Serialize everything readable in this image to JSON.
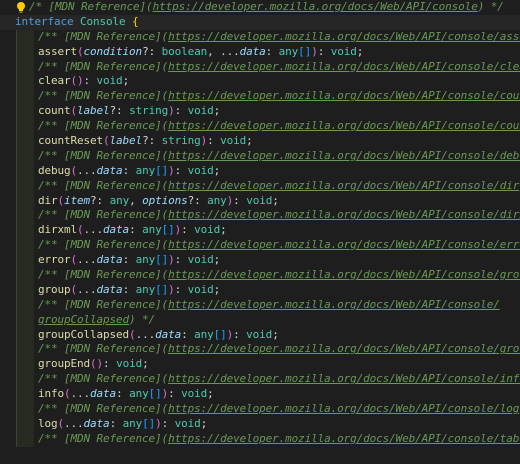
{
  "editor": {
    "icon": "lightbulb-icon",
    "lines": [
      {
        "kind": "top-comment",
        "tokens": [
          {
            "t": "/* ",
            "c": "t-comment"
          },
          {
            "t": "[MDN Reference](",
            "c": "t-comment"
          },
          {
            "t": "https://developer.mozilla.org/docs/Web/API/console",
            "c": "t-link"
          },
          {
            "t": ") */",
            "c": "t-comment"
          }
        ]
      },
      {
        "kind": "decl",
        "tokens": [
          {
            "t": "interface",
            "c": "t-keyword"
          },
          {
            "t": " ",
            "c": "t-punct"
          },
          {
            "t": "Console",
            "c": "t-type"
          },
          {
            "t": " ",
            "c": "t-punct"
          },
          {
            "t": "{",
            "c": "t-brace"
          }
        ]
      },
      {
        "kind": "comment",
        "tokens": [
          {
            "t": "/** [MDN Reference](",
            "c": "t-comment"
          },
          {
            "t": "https://developer.mozilla.org/docs/Web/API/console/assert",
            "c": "t-link"
          },
          {
            "t": ") */",
            "c": "t-comment"
          }
        ]
      },
      {
        "kind": "code",
        "tokens": [
          {
            "t": "assert",
            "c": "t-func"
          },
          {
            "t": "(",
            "c": "t-paren"
          },
          {
            "t": "condition",
            "c": "t-param"
          },
          {
            "t": "?: ",
            "c": "t-punct"
          },
          {
            "t": "boolean",
            "c": "t-type"
          },
          {
            "t": ", ...",
            "c": "t-punct"
          },
          {
            "t": "data",
            "c": "t-param"
          },
          {
            "t": ": ",
            "c": "t-punct"
          },
          {
            "t": "any",
            "c": "t-type"
          },
          {
            "t": "[]",
            "c": "t-bracket"
          },
          {
            "t": ")",
            "c": "t-paren"
          },
          {
            "t": ": ",
            "c": "t-punct"
          },
          {
            "t": "void",
            "c": "t-type"
          },
          {
            "t": ";",
            "c": "t-punct"
          }
        ]
      },
      {
        "kind": "comment",
        "tokens": [
          {
            "t": "/** [MDN Reference](",
            "c": "t-comment"
          },
          {
            "t": "https://developer.mozilla.org/docs/Web/API/console/clear",
            "c": "t-link"
          },
          {
            "t": ") */",
            "c": "t-comment"
          }
        ]
      },
      {
        "kind": "code",
        "tokens": [
          {
            "t": "clear",
            "c": "t-func"
          },
          {
            "t": "()",
            "c": "t-paren"
          },
          {
            "t": ": ",
            "c": "t-punct"
          },
          {
            "t": "void",
            "c": "t-type"
          },
          {
            "t": ";",
            "c": "t-punct"
          }
        ]
      },
      {
        "kind": "comment",
        "tokens": [
          {
            "t": "/** [MDN Reference](",
            "c": "t-comment"
          },
          {
            "t": "https://developer.mozilla.org/docs/Web/API/console/count",
            "c": "t-link"
          },
          {
            "t": ") */",
            "c": "t-comment"
          }
        ]
      },
      {
        "kind": "code",
        "tokens": [
          {
            "t": "count",
            "c": "t-func"
          },
          {
            "t": "(",
            "c": "t-paren"
          },
          {
            "t": "label",
            "c": "t-param"
          },
          {
            "t": "?: ",
            "c": "t-punct"
          },
          {
            "t": "string",
            "c": "t-type"
          },
          {
            "t": ")",
            "c": "t-paren"
          },
          {
            "t": ": ",
            "c": "t-punct"
          },
          {
            "t": "void",
            "c": "t-type"
          },
          {
            "t": ";",
            "c": "t-punct"
          }
        ]
      },
      {
        "kind": "comment",
        "tokens": [
          {
            "t": "/** [MDN Reference](",
            "c": "t-comment"
          },
          {
            "t": "https://developer.mozilla.org/docs/Web/API/console/countReset",
            "c": "t-link"
          }
        ]
      },
      {
        "kind": "code",
        "tokens": [
          {
            "t": "countReset",
            "c": "t-func"
          },
          {
            "t": "(",
            "c": "t-paren"
          },
          {
            "t": "label",
            "c": "t-param"
          },
          {
            "t": "?: ",
            "c": "t-punct"
          },
          {
            "t": "string",
            "c": "t-type"
          },
          {
            "t": ")",
            "c": "t-paren"
          },
          {
            "t": ": ",
            "c": "t-punct"
          },
          {
            "t": "void",
            "c": "t-type"
          },
          {
            "t": ";",
            "c": "t-punct"
          }
        ]
      },
      {
        "kind": "comment",
        "tokens": [
          {
            "t": "/** [MDN Reference](",
            "c": "t-comment"
          },
          {
            "t": "https://developer.mozilla.org/docs/Web/API/console/debug",
            "c": "t-link"
          },
          {
            "t": ") */",
            "c": "t-comment"
          }
        ]
      },
      {
        "kind": "code",
        "tokens": [
          {
            "t": "debug",
            "c": "t-func"
          },
          {
            "t": "(",
            "c": "t-paren"
          },
          {
            "t": "...",
            "c": "t-punct"
          },
          {
            "t": "data",
            "c": "t-param"
          },
          {
            "t": ": ",
            "c": "t-punct"
          },
          {
            "t": "any",
            "c": "t-type"
          },
          {
            "t": "[]",
            "c": "t-bracket"
          },
          {
            "t": ")",
            "c": "t-paren"
          },
          {
            "t": ": ",
            "c": "t-punct"
          },
          {
            "t": "void",
            "c": "t-type"
          },
          {
            "t": ";",
            "c": "t-punct"
          }
        ]
      },
      {
        "kind": "comment",
        "tokens": [
          {
            "t": "/** [MDN Reference](",
            "c": "t-comment"
          },
          {
            "t": "https://developer.mozilla.org/docs/Web/API/console/dir",
            "c": "t-link"
          },
          {
            "t": ") */",
            "c": "t-comment"
          }
        ]
      },
      {
        "kind": "code",
        "tokens": [
          {
            "t": "dir",
            "c": "t-func"
          },
          {
            "t": "(",
            "c": "t-paren"
          },
          {
            "t": "item",
            "c": "t-param"
          },
          {
            "t": "?: ",
            "c": "t-punct"
          },
          {
            "t": "any",
            "c": "t-type"
          },
          {
            "t": ", ",
            "c": "t-punct"
          },
          {
            "t": "options",
            "c": "t-param"
          },
          {
            "t": "?: ",
            "c": "t-punct"
          },
          {
            "t": "any",
            "c": "t-type"
          },
          {
            "t": ")",
            "c": "t-paren"
          },
          {
            "t": ": ",
            "c": "t-punct"
          },
          {
            "t": "void",
            "c": "t-type"
          },
          {
            "t": ";",
            "c": "t-punct"
          }
        ]
      },
      {
        "kind": "comment",
        "tokens": [
          {
            "t": "/** [MDN Reference](",
            "c": "t-comment"
          },
          {
            "t": "https://developer.mozilla.org/docs/Web/API/console/dirxml",
            "c": "t-link"
          },
          {
            "t": ") */",
            "c": "t-comment"
          }
        ]
      },
      {
        "kind": "code",
        "tokens": [
          {
            "t": "dirxml",
            "c": "t-func"
          },
          {
            "t": "(",
            "c": "t-paren"
          },
          {
            "t": "...",
            "c": "t-punct"
          },
          {
            "t": "data",
            "c": "t-param"
          },
          {
            "t": ": ",
            "c": "t-punct"
          },
          {
            "t": "any",
            "c": "t-type"
          },
          {
            "t": "[]",
            "c": "t-bracket"
          },
          {
            "t": ")",
            "c": "t-paren"
          },
          {
            "t": ": ",
            "c": "t-punct"
          },
          {
            "t": "void",
            "c": "t-type"
          },
          {
            "t": ";",
            "c": "t-punct"
          }
        ]
      },
      {
        "kind": "comment",
        "tokens": [
          {
            "t": "/** [MDN Reference](",
            "c": "t-comment"
          },
          {
            "t": "https://developer.mozilla.org/docs/Web/API/console/error",
            "c": "t-link"
          },
          {
            "t": ") */",
            "c": "t-comment"
          }
        ]
      },
      {
        "kind": "code",
        "tokens": [
          {
            "t": "error",
            "c": "t-func"
          },
          {
            "t": "(",
            "c": "t-paren"
          },
          {
            "t": "...",
            "c": "t-punct"
          },
          {
            "t": "data",
            "c": "t-param"
          },
          {
            "t": ": ",
            "c": "t-punct"
          },
          {
            "t": "any",
            "c": "t-type"
          },
          {
            "t": "[]",
            "c": "t-bracket"
          },
          {
            "t": ")",
            "c": "t-paren"
          },
          {
            "t": ": ",
            "c": "t-punct"
          },
          {
            "t": "void",
            "c": "t-type"
          },
          {
            "t": ";",
            "c": "t-punct"
          }
        ]
      },
      {
        "kind": "comment",
        "tokens": [
          {
            "t": "/** [MDN Reference](",
            "c": "t-comment"
          },
          {
            "t": "https://developer.mozilla.org/docs/Web/API/console/group",
            "c": "t-link"
          },
          {
            "t": ") */",
            "c": "t-comment"
          }
        ]
      },
      {
        "kind": "code",
        "tokens": [
          {
            "t": "group",
            "c": "t-func"
          },
          {
            "t": "(",
            "c": "t-paren"
          },
          {
            "t": "...",
            "c": "t-punct"
          },
          {
            "t": "data",
            "c": "t-param"
          },
          {
            "t": ": ",
            "c": "t-punct"
          },
          {
            "t": "any",
            "c": "t-type"
          },
          {
            "t": "[]",
            "c": "t-bracket"
          },
          {
            "t": ")",
            "c": "t-paren"
          },
          {
            "t": ": ",
            "c": "t-punct"
          },
          {
            "t": "void",
            "c": "t-type"
          },
          {
            "t": ";",
            "c": "t-punct"
          }
        ]
      },
      {
        "kind": "comment",
        "tokens": [
          {
            "t": "/** [MDN Reference](",
            "c": "t-comment"
          },
          {
            "t": "https://developer.mozilla.org/docs/Web/API/console/",
            "c": "t-link"
          }
        ]
      },
      {
        "kind": "comment-wrap",
        "tokens": [
          {
            "t": "groupCollapsed",
            "c": "t-link"
          },
          {
            "t": ") */",
            "c": "t-comment"
          }
        ]
      },
      {
        "kind": "code",
        "tokens": [
          {
            "t": "groupCollapsed",
            "c": "t-func"
          },
          {
            "t": "(",
            "c": "t-paren"
          },
          {
            "t": "...",
            "c": "t-punct"
          },
          {
            "t": "data",
            "c": "t-param"
          },
          {
            "t": ": ",
            "c": "t-punct"
          },
          {
            "t": "any",
            "c": "t-type"
          },
          {
            "t": "[]",
            "c": "t-bracket"
          },
          {
            "t": ")",
            "c": "t-paren"
          },
          {
            "t": ": ",
            "c": "t-punct"
          },
          {
            "t": "void",
            "c": "t-type"
          },
          {
            "t": ";",
            "c": "t-punct"
          }
        ]
      },
      {
        "kind": "comment",
        "tokens": [
          {
            "t": "/** [MDN Reference](",
            "c": "t-comment"
          },
          {
            "t": "https://developer.mozilla.org/docs/Web/API/console/groupEnd",
            "c": "t-link"
          },
          {
            "t": ")",
            "c": "t-comment"
          }
        ]
      },
      {
        "kind": "code",
        "tokens": [
          {
            "t": "groupEnd",
            "c": "t-func"
          },
          {
            "t": "()",
            "c": "t-paren"
          },
          {
            "t": ": ",
            "c": "t-punct"
          },
          {
            "t": "void",
            "c": "t-type"
          },
          {
            "t": ";",
            "c": "t-punct"
          }
        ]
      },
      {
        "kind": "comment",
        "tokens": [
          {
            "t": "/** [MDN Reference](",
            "c": "t-comment"
          },
          {
            "t": "https://developer.mozilla.org/docs/Web/API/console/info",
            "c": "t-link"
          },
          {
            "t": ") */",
            "c": "t-comment"
          }
        ]
      },
      {
        "kind": "code",
        "tokens": [
          {
            "t": "info",
            "c": "t-func"
          },
          {
            "t": "(",
            "c": "t-paren"
          },
          {
            "t": "...",
            "c": "t-punct"
          },
          {
            "t": "data",
            "c": "t-param"
          },
          {
            "t": ": ",
            "c": "t-punct"
          },
          {
            "t": "any",
            "c": "t-type"
          },
          {
            "t": "[]",
            "c": "t-bracket"
          },
          {
            "t": ")",
            "c": "t-paren"
          },
          {
            "t": ": ",
            "c": "t-punct"
          },
          {
            "t": "void",
            "c": "t-type"
          },
          {
            "t": ";",
            "c": "t-punct"
          }
        ]
      },
      {
        "kind": "comment",
        "tokens": [
          {
            "t": "/** [MDN Reference](",
            "c": "t-comment"
          },
          {
            "t": "https://developer.mozilla.org/docs/Web/API/console/log",
            "c": "t-link"
          },
          {
            "t": ") */",
            "c": "t-comment"
          }
        ]
      },
      {
        "kind": "code",
        "tokens": [
          {
            "t": "log",
            "c": "t-func"
          },
          {
            "t": "(",
            "c": "t-paren"
          },
          {
            "t": "...",
            "c": "t-punct"
          },
          {
            "t": "data",
            "c": "t-param"
          },
          {
            "t": ": ",
            "c": "t-punct"
          },
          {
            "t": "any",
            "c": "t-type"
          },
          {
            "t": "[]",
            "c": "t-bracket"
          },
          {
            "t": ")",
            "c": "t-paren"
          },
          {
            "t": ": ",
            "c": "t-punct"
          },
          {
            "t": "void",
            "c": "t-type"
          },
          {
            "t": ";",
            "c": "t-punct"
          }
        ]
      },
      {
        "kind": "comment",
        "tokens": [
          {
            "t": "/** [MDN Reference](",
            "c": "t-comment"
          },
          {
            "t": "https://developer.mozilla.org/docs/Web/API/console/table",
            "c": "t-link"
          },
          {
            "t": ") */",
            "c": "t-comment"
          }
        ]
      }
    ]
  }
}
